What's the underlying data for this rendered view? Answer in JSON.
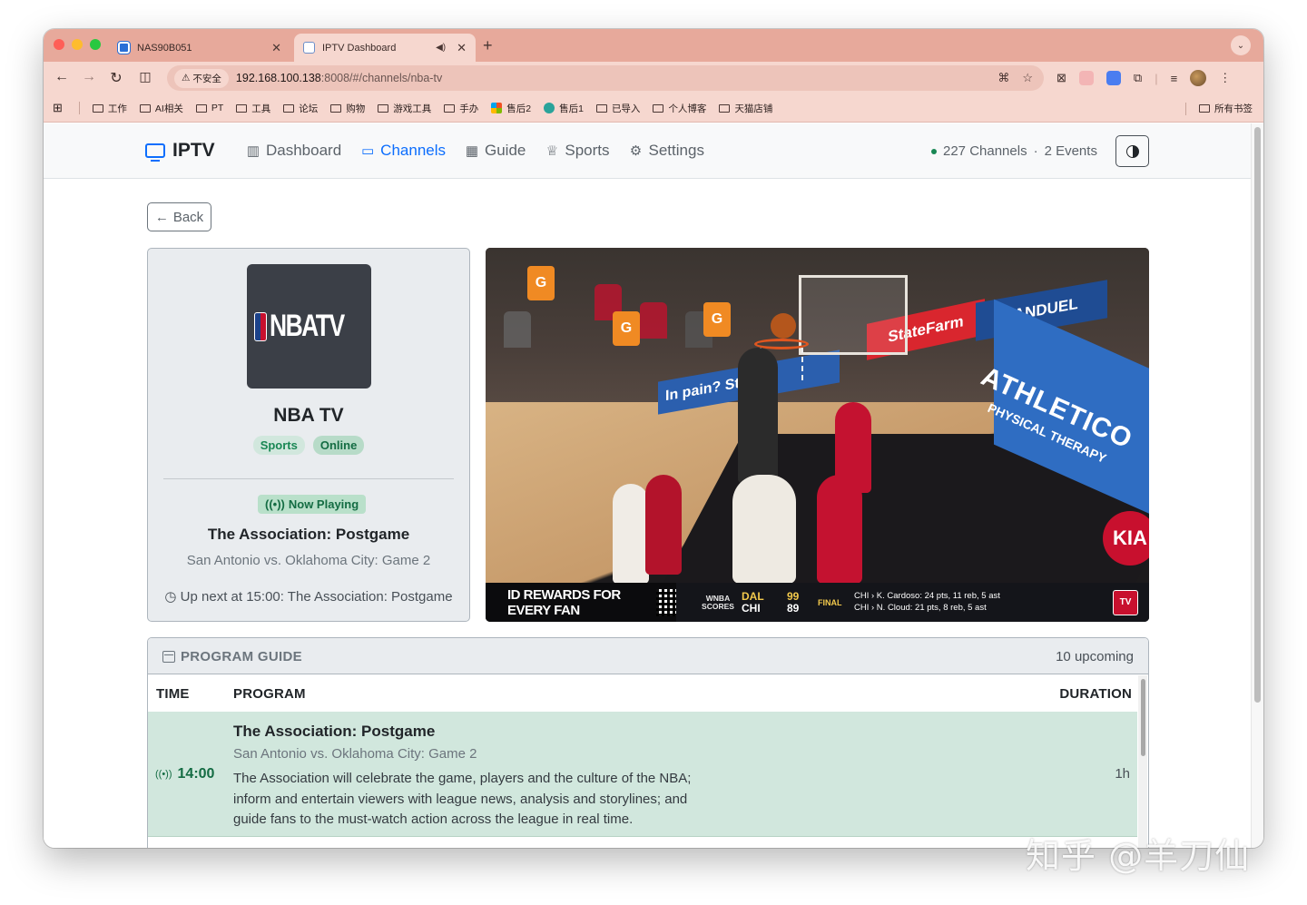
{
  "browser": {
    "tabs": [
      {
        "title": "NAS90B051"
      },
      {
        "title": "IPTV Dashboard"
      }
    ],
    "toolbar": {
      "insecure_label": "不安全",
      "url_host": "192.168.100.138",
      "url_path": ":8008/#/channels/nba-tv"
    },
    "bookmarks": [
      "工作",
      "AI相关",
      "PT",
      "工具",
      "论坛",
      "购物",
      "游戏工具",
      "手办",
      "售后2",
      "售后1",
      "已导入",
      "个人博客",
      "天猫店铺"
    ],
    "all_bookmarks": "所有书签"
  },
  "app": {
    "brand": "IPTV",
    "nav": [
      {
        "label": "Dashboard",
        "icon": "dashboard-icon"
      },
      {
        "label": "Channels",
        "icon": "tv-icon",
        "active": true
      },
      {
        "label": "Guide",
        "icon": "calendar-icon"
      },
      {
        "label": "Sports",
        "icon": "trophy-icon"
      },
      {
        "label": "Settings",
        "icon": "gear-icon"
      }
    ],
    "status": {
      "channels": "227 Channels",
      "separator": "·",
      "events": "2 Events"
    },
    "accent": "#0d6efd"
  },
  "back_label": "Back",
  "channel": {
    "logo_text": "NBATV",
    "name": "NBA TV",
    "category": "Sports",
    "status": "Online",
    "now_playing_label": "Now Playing",
    "now_title": "The Association: Postgame",
    "now_subtitle": "San Antonio vs. Oklahoma City: Game 2",
    "up_next": "Up next at 15:00: The Association: Postgame"
  },
  "video": {
    "ads": {
      "fanduel": "FANDUEL",
      "statefarm": "StateFarm",
      "athletico": "ATHLETICO",
      "athletico_sub": "PHYSICAL THERAPY",
      "in_pain": "In pain? St",
      "kia": "KIA",
      "cooler": "G"
    },
    "ticker": {
      "promo": "ID REWARDS FOR EVERY FAN",
      "league_line1": "WNBA",
      "league_line2": "SCORES",
      "team1": "DAL",
      "score1": "99",
      "team2": "CHI",
      "score2": "89",
      "final": "FINAL",
      "note1": "CHI › K. Cardoso: 24 pts, 11 reb, 5 ast",
      "note2": "CHI › N. Cloud: 21 pts, 8 reb, 5 ast",
      "logo": "TV"
    }
  },
  "guide": {
    "title": "PROGRAM GUIDE",
    "count": "10 upcoming",
    "columns": {
      "time": "TIME",
      "program": "PROGRAM",
      "duration": "DURATION"
    },
    "rows": [
      {
        "time": "14:00",
        "title": "The Association: Postgame",
        "subtitle": "San Antonio vs. Oklahoma City: Game 2",
        "description": "The Association will celebrate the game, players and the culture of the NBA; inform and entertain viewers with league news, analysis and storylines; and guide fans to the must-watch action across the league in real time.",
        "duration": "1h"
      }
    ]
  },
  "watermark": "知乎 @羊刀仙"
}
